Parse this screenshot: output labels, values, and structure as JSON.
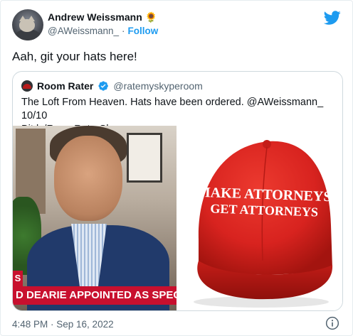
{
  "author": {
    "display_name": "Andrew Weissmann",
    "emoji": "🌻",
    "handle": "@AWeissmann_",
    "separator": "·",
    "follow_label": "Follow"
  },
  "tweet": {
    "text": "Aah, git your hats here!",
    "timestamp": "4:48 PM · Sep 16, 2022"
  },
  "quoted": {
    "display_name": "Room Rater",
    "handle": "@ratemyskyperoom",
    "text_line1": "The Loft From Heaven. Hats have been ordered. @AWeissmann_ 10/10",
    "text_line2": "Bit.ly/RoomRaterShop"
  },
  "media": {
    "chyron": "D DEARIE APPOINTED AS SPECIAL MAST",
    "chyron_tag": "S",
    "hat_line1": "MAKE ATTORNEYS",
    "hat_line2": "GET ATTORNEYS"
  },
  "icons": {
    "bird": "twitter-bird-icon",
    "verified": "verified-badge-icon",
    "info": "info-icon"
  },
  "colors": {
    "accent": "#1d9bf0",
    "hat_red": "#d8231f",
    "chyron_red": "#c8102e"
  }
}
